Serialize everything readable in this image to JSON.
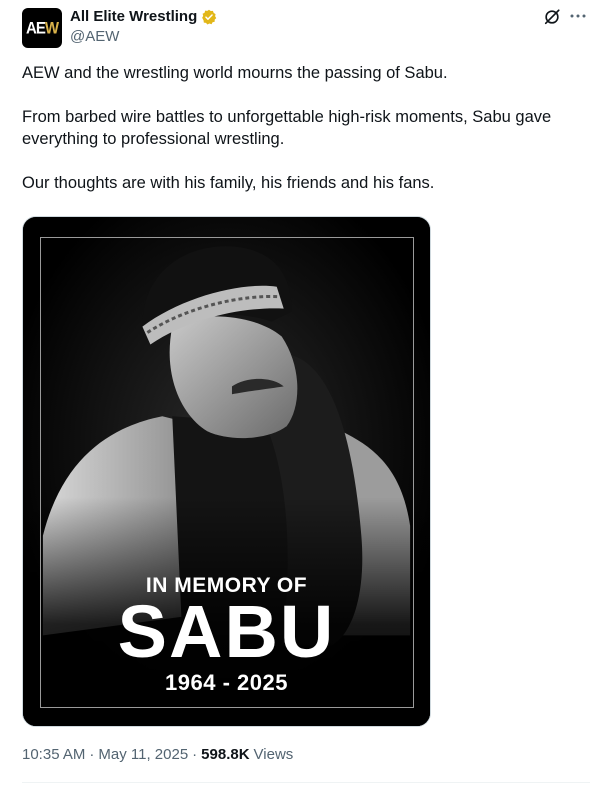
{
  "author": {
    "display_name": "All Elite Wrestling",
    "handle": "@AEW",
    "avatar_text_a": "AE",
    "avatar_text_b": "W",
    "verified_color": "#e2b719"
  },
  "tweet": {
    "paragraphs": [
      "AEW and the wrestling world mourns the passing of Sabu.",
      "From barbed wire battles to unforgettable high-risk moments, Sabu gave everything to professional wrestling.",
      "Our thoughts are with his family, his friends and his fans."
    ]
  },
  "media": {
    "line1": "IN MEMORY OF",
    "line2": "SABU",
    "line3": "1964 - 2025"
  },
  "meta": {
    "time": "10:35 AM",
    "separator": "·",
    "date": "May 11, 2025",
    "views_count": "598.8K",
    "views_label": "Views"
  },
  "icons": {
    "grok": "grok-icon",
    "more": "more-icon",
    "verified": "verified-badge-icon"
  }
}
